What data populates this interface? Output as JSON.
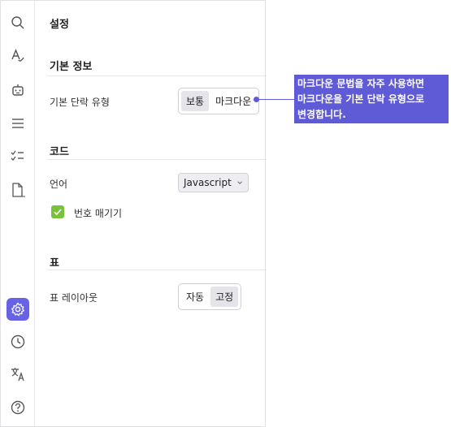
{
  "sidebar": {
    "icons": [
      "search-icon",
      "spellcheck-icon",
      "robot-icon",
      "menu-lines-icon",
      "checklist-icon",
      "document-icon",
      "settings-gear-icon",
      "clock-icon",
      "translate-icon",
      "help-icon"
    ],
    "active": "settings-gear-icon",
    "accent": "#6863e6"
  },
  "page": {
    "title": "설정"
  },
  "basic": {
    "section_title": "기본 정보",
    "paragraph_type_label": "기본 단락 유형",
    "options": [
      "보통",
      "마크다운"
    ],
    "selected": "보통"
  },
  "code": {
    "section_title": "코드",
    "language_label": "언어",
    "language_value": "Javascript",
    "line_numbers_label": "번호 매기기",
    "line_numbers_checked": true
  },
  "table": {
    "section_title": "표",
    "layout_label": "표 레이아웃",
    "options": [
      "자동",
      "고정"
    ],
    "selected": "고정"
  },
  "callout": {
    "text_line1": "마크다운 문법을 자주 사용하면",
    "text_line2": "마크다운을 기본 단락 유형으로",
    "text_line3": "변경합니다.",
    "color": "#5f5ad6"
  }
}
